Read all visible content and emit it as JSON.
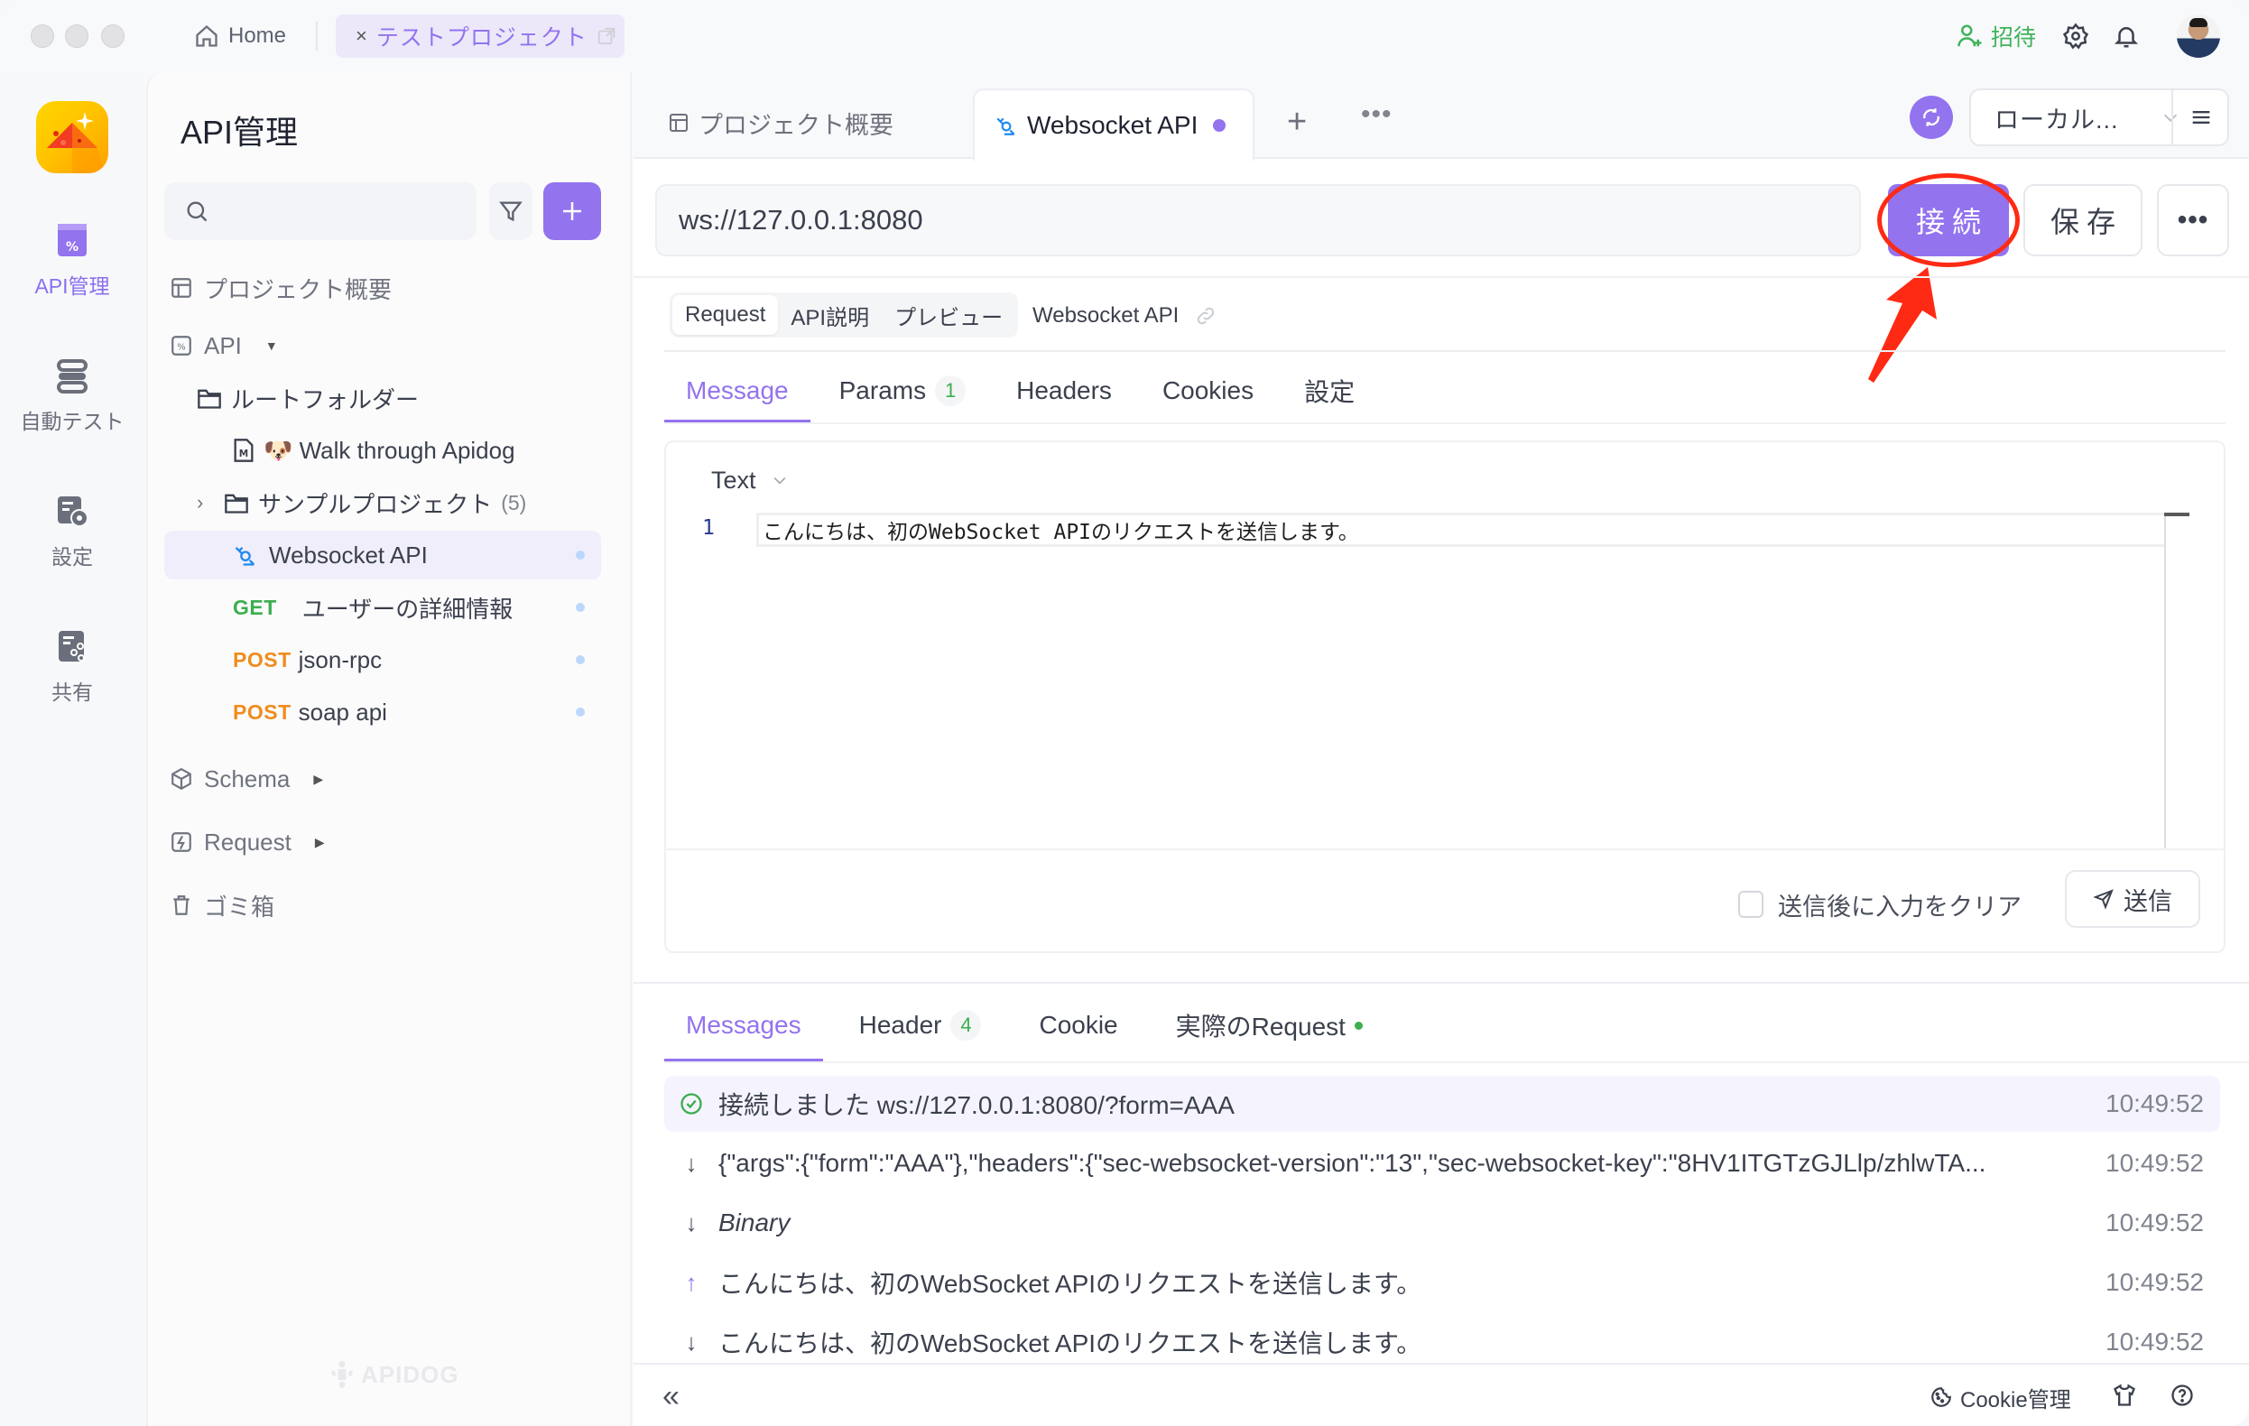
{
  "titlebar": {
    "home_label": "Home",
    "project_tab": {
      "close": "×",
      "name": "テストプロジェクト"
    },
    "invite_label": "招待",
    "icons": [
      "settings-icon",
      "bell-icon",
      "avatar"
    ]
  },
  "rail": {
    "items": [
      {
        "label": "API管理",
        "icon": "api-management-icon",
        "active": true
      },
      {
        "label": "自動テスト",
        "icon": "auto-test-icon",
        "active": false
      },
      {
        "label": "設定",
        "icon": "settings-icon",
        "active": false
      },
      {
        "label": "共有",
        "icon": "share-icon",
        "active": false
      }
    ]
  },
  "sidebar": {
    "title": "API管理",
    "search_placeholder": "",
    "tree": {
      "overview": "プロジェクト概要",
      "api": "API",
      "root_folder": "ルートフォルダー",
      "walkthrough": "🐶 Walk through Apidog",
      "sample_project": "サンプルプロジェクト",
      "sample_count": "(5)",
      "websocket": "Websocket API",
      "get_method": "GET",
      "get_name": "ユーザーの詳細情報",
      "post1_method": "POST",
      "post1_name": "json-rpc",
      "post2_method": "POST",
      "post2_name": "soap api",
      "schema": "Schema",
      "request": "Request",
      "trash": "ゴミ箱"
    },
    "watermark": "APIDOG"
  },
  "main": {
    "tabs": {
      "overview": "プロジェクト概要",
      "active": "Websocket API"
    },
    "environment": "ローカル...",
    "url": "ws://127.0.0.1:8080",
    "connect_label": "接続",
    "save_label": "保存",
    "more_label": "•••",
    "segments": [
      "Request",
      "API説明",
      "プレビュー"
    ],
    "api_name": "Websocket API",
    "request_tabs": [
      {
        "label": "Message",
        "active": true
      },
      {
        "label": "Params",
        "badge": "1"
      },
      {
        "label": "Headers"
      },
      {
        "label": "Cookies"
      },
      {
        "label": "設定"
      }
    ],
    "editor": {
      "format": "Text",
      "line_number": "1",
      "content": "こんにちは、初のWebSocket APIのリクエストを送信します。"
    },
    "clear_after_send_label": "送信後に入力をクリア",
    "clear_after_send_checked": false,
    "send_label": "送信",
    "response_tabs": [
      {
        "label": "Messages",
        "active": true
      },
      {
        "label": "Header",
        "badge": "4"
      },
      {
        "label": "Cookie"
      },
      {
        "label": "実際のRequest",
        "dot": true
      }
    ],
    "messages": [
      {
        "type": "connected",
        "text": "接続しました ws://127.0.0.1:8080/?form=AAA",
        "time": "10:49:52"
      },
      {
        "type": "received",
        "text": "{\"args\":{\"form\":\"AAA\"},\"headers\":{\"sec-websocket-version\":\"13\",\"sec-websocket-key\":\"8HV1ITGTzGJLlp/zhlwTA...",
        "time": "10:49:52"
      },
      {
        "type": "received",
        "text": "Binary",
        "time": "10:49:52"
      },
      {
        "type": "sent",
        "text": "こんにちは、初のWebSocket APIのリクエストを送信します。",
        "time": "10:49:52"
      },
      {
        "type": "received",
        "text": "こんにちは、初のWebSocket APIのリクエストを送信します。",
        "time": "10:49:52"
      }
    ],
    "footer": {
      "collapse": "«",
      "cookie_manager": "Cookie管理"
    }
  },
  "colors": {
    "accent": "#9373ee",
    "get": "#3bae4f",
    "post": "#f08c1c",
    "annotation": "#ff2a14"
  }
}
